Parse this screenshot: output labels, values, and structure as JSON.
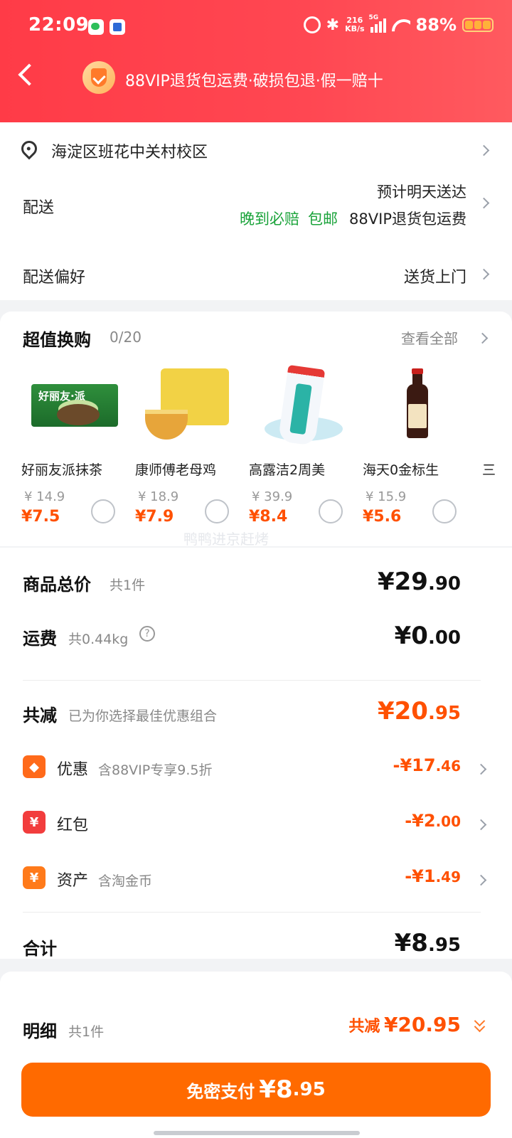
{
  "status_bar": {
    "time": "22:09",
    "net_speed": "216",
    "net_unit": "KB/s",
    "network": "5G",
    "battery": "88%"
  },
  "header": {
    "banner": "88VIP退货包运费·破损包退·假一赔十"
  },
  "address": {
    "text": "海淀区班花中关村校区"
  },
  "shipping": {
    "label": "配送",
    "eta": "预计明天送达",
    "tag_late": "晚到必赔",
    "tag_free": "包邮",
    "tag_vip": "88VIP退货包运费"
  },
  "preference": {
    "label": "配送偏好",
    "value": "送货上门"
  },
  "deals": {
    "title": "超值换购",
    "count": "0/20",
    "view_all": "查看全部",
    "items": [
      {
        "name": "好丽友派抹茶",
        "orig": "¥ 14.9",
        "price": "¥7.5"
      },
      {
        "name": "康师傅老母鸡",
        "orig": "¥ 18.9",
        "price": "¥7.9"
      },
      {
        "name": "高露洁2周美",
        "orig": "¥ 39.9",
        "price": "¥8.4"
      },
      {
        "name": "海天0金标生",
        "orig": "¥ 15.9",
        "price": "¥5.6"
      }
    ],
    "partial_item": "三"
  },
  "watermark": "鸭鸭进京赶烤",
  "summary": {
    "total_label": "商品总价",
    "total_count": "共1件",
    "total_int": "¥29",
    "total_dec": ".90",
    "freight_label": "运费",
    "freight_weight": "共0.44kg",
    "freight_int": "¥0",
    "freight_dec": ".00",
    "saved_label": "共减",
    "saved_note": "已为你选择最佳优惠组合",
    "saved_int": "¥20",
    "saved_dec": ".95",
    "discounts": [
      {
        "icon": "tag-icon",
        "label": "优惠",
        "sub": "含88VIP专享9.5折",
        "int": "-¥17",
        "dec": ".46"
      },
      {
        "icon": "red-envelope-icon",
        "label": "红包",
        "sub": "",
        "int": "-¥2",
        "dec": ".00"
      },
      {
        "icon": "yuan-icon",
        "label": "资产",
        "sub": "含淘金币",
        "int": "-¥1",
        "dec": ".49"
      }
    ],
    "grand_label": "合计",
    "grand_int": "¥8",
    "grand_dec": ".95"
  },
  "footer": {
    "detail_label": "明细",
    "detail_count": "共1件",
    "saved_label": "共减",
    "saved_amount": "¥20.95",
    "pay_label": "免密支付",
    "pay_int": "¥8",
    "pay_dec": ".95"
  },
  "colors": {
    "header_red": "#ff3b47",
    "accent_orange": "#ff5000",
    "pay_button": "#ff6a00",
    "green_tag": "#1aa33a"
  }
}
